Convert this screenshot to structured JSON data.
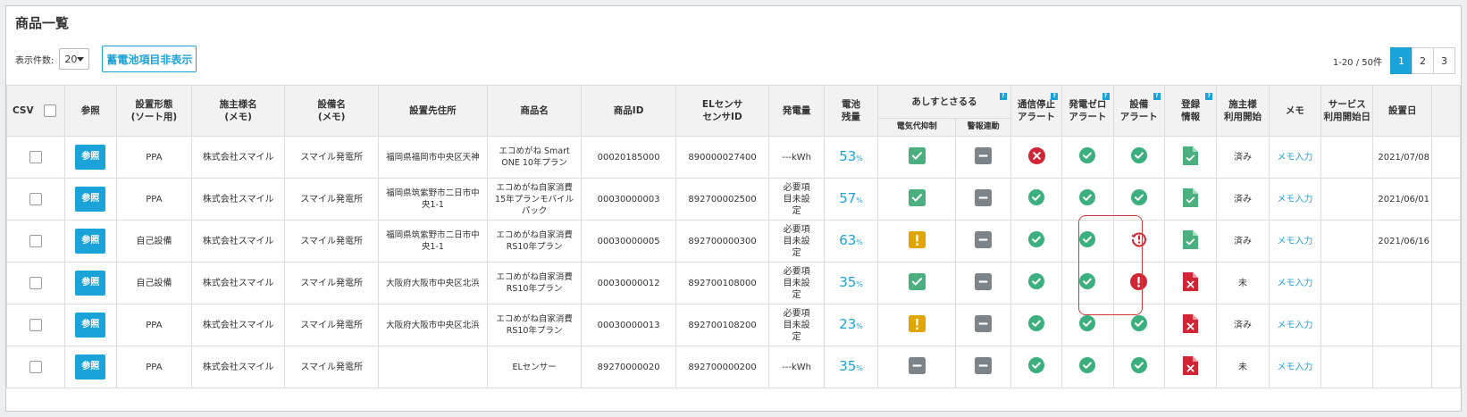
{
  "title": "商品一覧",
  "controls": {
    "per_page_label": "表示件数:",
    "per_page_value": "20",
    "toggle_label": "蓄電池項目非表示"
  },
  "pager": {
    "count": "1-20 / 50件",
    "pages": [
      "1",
      "2",
      "3"
    ]
  },
  "headers": {
    "csv": "CSV",
    "ref": "参照",
    "type": "設置形態\n(ソート用)",
    "owner": "施主様名\n(メモ)",
    "facility": "設備名\n(メモ)",
    "address": "設置先住所",
    "product": "商品名",
    "product_id": "商品ID",
    "sensor": "ELセンサ\nセンサID",
    "generation": "発電量",
    "battery": "電池\n残量",
    "ashisuto": "あしすとさるる",
    "ashisuto_sub1": "電気代抑制",
    "ashisuto_sub2": "警報連動",
    "comm_alert": "通信停止\nアラート",
    "gen_zero": "発電ゼロ\nアラート",
    "equip_alert": "設備\nアラート",
    "registration": "登録\n情報",
    "owner_start": "施主様\n利用開始",
    "memo": "メモ",
    "service_start": "サービス\n利用開始日",
    "install_date": "設置日"
  },
  "rows": [
    {
      "ref": "参照",
      "type": "PPA",
      "owner": "株式会社スマイル",
      "facility": "スマイル発電所",
      "address": "福岡県福岡市中央区天神",
      "product": "エコめがね Smart ONE 10年プラン",
      "product_id": "00020185000",
      "sensor_id": "890000027400",
      "generation": "---kWh",
      "battery": "53",
      "ashisuto1": "check",
      "ashisuto2": "minus",
      "comm": "error",
      "gen_zero": "ok",
      "equip": "ok",
      "reg": "doc-ok",
      "owner_start": "済み",
      "memo": "メモ入力",
      "service_start": "",
      "install_date": "2021/07/08"
    },
    {
      "ref": "参照",
      "type": "PPA",
      "owner": "株式会社スマイル",
      "facility": "スマイル発電所",
      "address": "福岡県筑紫野市二日市中央1-1",
      "product": "エコめがね自家消費15年プランモバイルパック",
      "product_id": "00030000003",
      "sensor_id": "892700002500",
      "generation": "必要項目未設定",
      "battery": "57",
      "ashisuto1": "check",
      "ashisuto2": "minus",
      "comm": "ok",
      "gen_zero": "ok",
      "equip": "ok",
      "reg": "doc-ok",
      "owner_start": "済み",
      "memo": "メモ入力",
      "service_start": "",
      "install_date": "2021/06/01"
    },
    {
      "ref": "参照",
      "type": "自己設備",
      "owner": "株式会社スマイル",
      "facility": "スマイル発電所",
      "address": "福岡県筑紫野市二日市中央1-1",
      "product": "エコめがね自家消費RS10年プラン",
      "product_id": "00030000005",
      "sensor_id": "892700000300",
      "generation": "必要項目未設定",
      "battery": "63",
      "ashisuto1": "warn",
      "ashisuto2": "minus",
      "comm": "ok",
      "gen_zero": "ok",
      "equip": "history",
      "reg": "doc-ok",
      "owner_start": "済み",
      "memo": "メモ入力",
      "service_start": "",
      "install_date": "2021/06/16"
    },
    {
      "ref": "参照",
      "type": "自己設備",
      "owner": "株式会社スマイル",
      "facility": "スマイル発電所",
      "address": "大阪府大阪市中央区北浜",
      "product": "エコめがね自家消費RS10年プラン",
      "product_id": "00030000012",
      "sensor_id": "892700108000",
      "generation": "必要項目未設定",
      "battery": "35",
      "ashisuto1": "check",
      "ashisuto2": "minus",
      "comm": "ok",
      "gen_zero": "ok",
      "equip": "alert",
      "reg": "doc-x",
      "owner_start": "未",
      "memo": "メモ入力",
      "service_start": "",
      "install_date": ""
    },
    {
      "ref": "参照",
      "type": "PPA",
      "owner": "株式会社スマイル",
      "facility": "スマイル発電所",
      "address": "大阪府大阪市中央区北浜",
      "product": "エコめがね自家消費RS10年プラン",
      "product_id": "00030000013",
      "sensor_id": "892700108200",
      "generation": "必要項目未設定",
      "battery": "23",
      "ashisuto1": "warn",
      "ashisuto2": "minus",
      "comm": "ok",
      "gen_zero": "ok",
      "equip": "ok",
      "reg": "doc-x",
      "owner_start": "済み",
      "memo": "メモ入力",
      "service_start": "",
      "install_date": ""
    },
    {
      "ref": "参照",
      "type": "PPA",
      "owner": "株式会社スマイル",
      "facility": "スマイル発電所",
      "address": "",
      "product": "ELセンサー",
      "product_id": "89270000020",
      "sensor_id": "892700000200",
      "generation": "---kWh",
      "battery": "35",
      "ashisuto1": "minus",
      "ashisuto2": "minus",
      "comm": "ok",
      "gen_zero": "ok",
      "equip": "ok",
      "reg": "doc-x",
      "owner_start": "未",
      "memo": "メモ入力",
      "service_start": "",
      "install_date": ""
    }
  ],
  "battery_unit": "%",
  "colors": {
    "accent": "#1aa3d8",
    "ok_green": "#3bb07e",
    "square_green": "#4caf80",
    "warn_yellow": "#e0a500",
    "error_red": "#cf2535",
    "minus_gray": "#7c8389"
  }
}
